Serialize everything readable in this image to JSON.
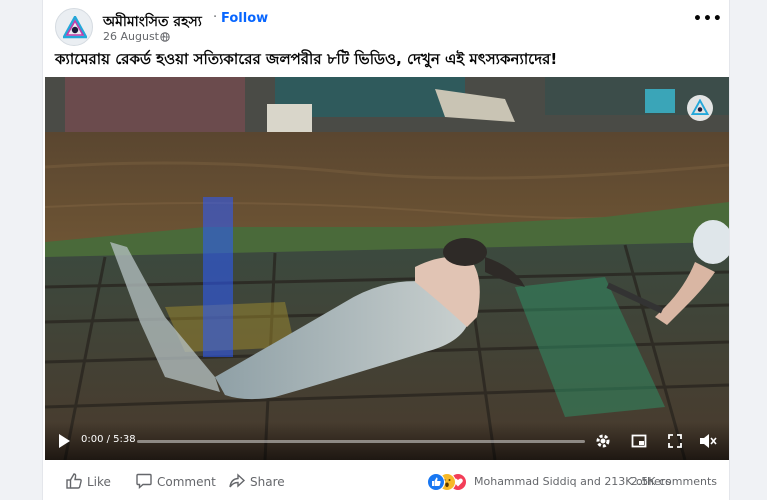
{
  "post": {
    "page_name": "অমীমাংসিত রহস্য",
    "separator": "·",
    "follow_label": "Follow",
    "date": "26 August ·",
    "more_label": "•••",
    "caption": "ক্যামেরায় রেকর্ড হওয়া সত্যিকারের জলপরীর ৮টি ভিডিও, দেখুন এই মৎস্যকন্যাদের!"
  },
  "video": {
    "time": "0:00 / 5:38",
    "progress": 0.0,
    "icons": [
      "play-icon",
      "settings-icon",
      "miniplayer-icon",
      "fullscreen-icon",
      "volume-muted-icon"
    ]
  },
  "actions": {
    "like_label": "Like",
    "comment_label": "Comment",
    "share_label": "Share"
  },
  "stats": {
    "reactions_text": "Mohammad Siddiq and 213K others",
    "comments_text": "2.5K comments",
    "reaction_types": [
      "like",
      "wow",
      "love"
    ]
  },
  "colors": {
    "accent": "#0866ff",
    "like_blue": "#1877f2",
    "wow_yellow": "#f7b928",
    "love_red": "#f33e58"
  }
}
